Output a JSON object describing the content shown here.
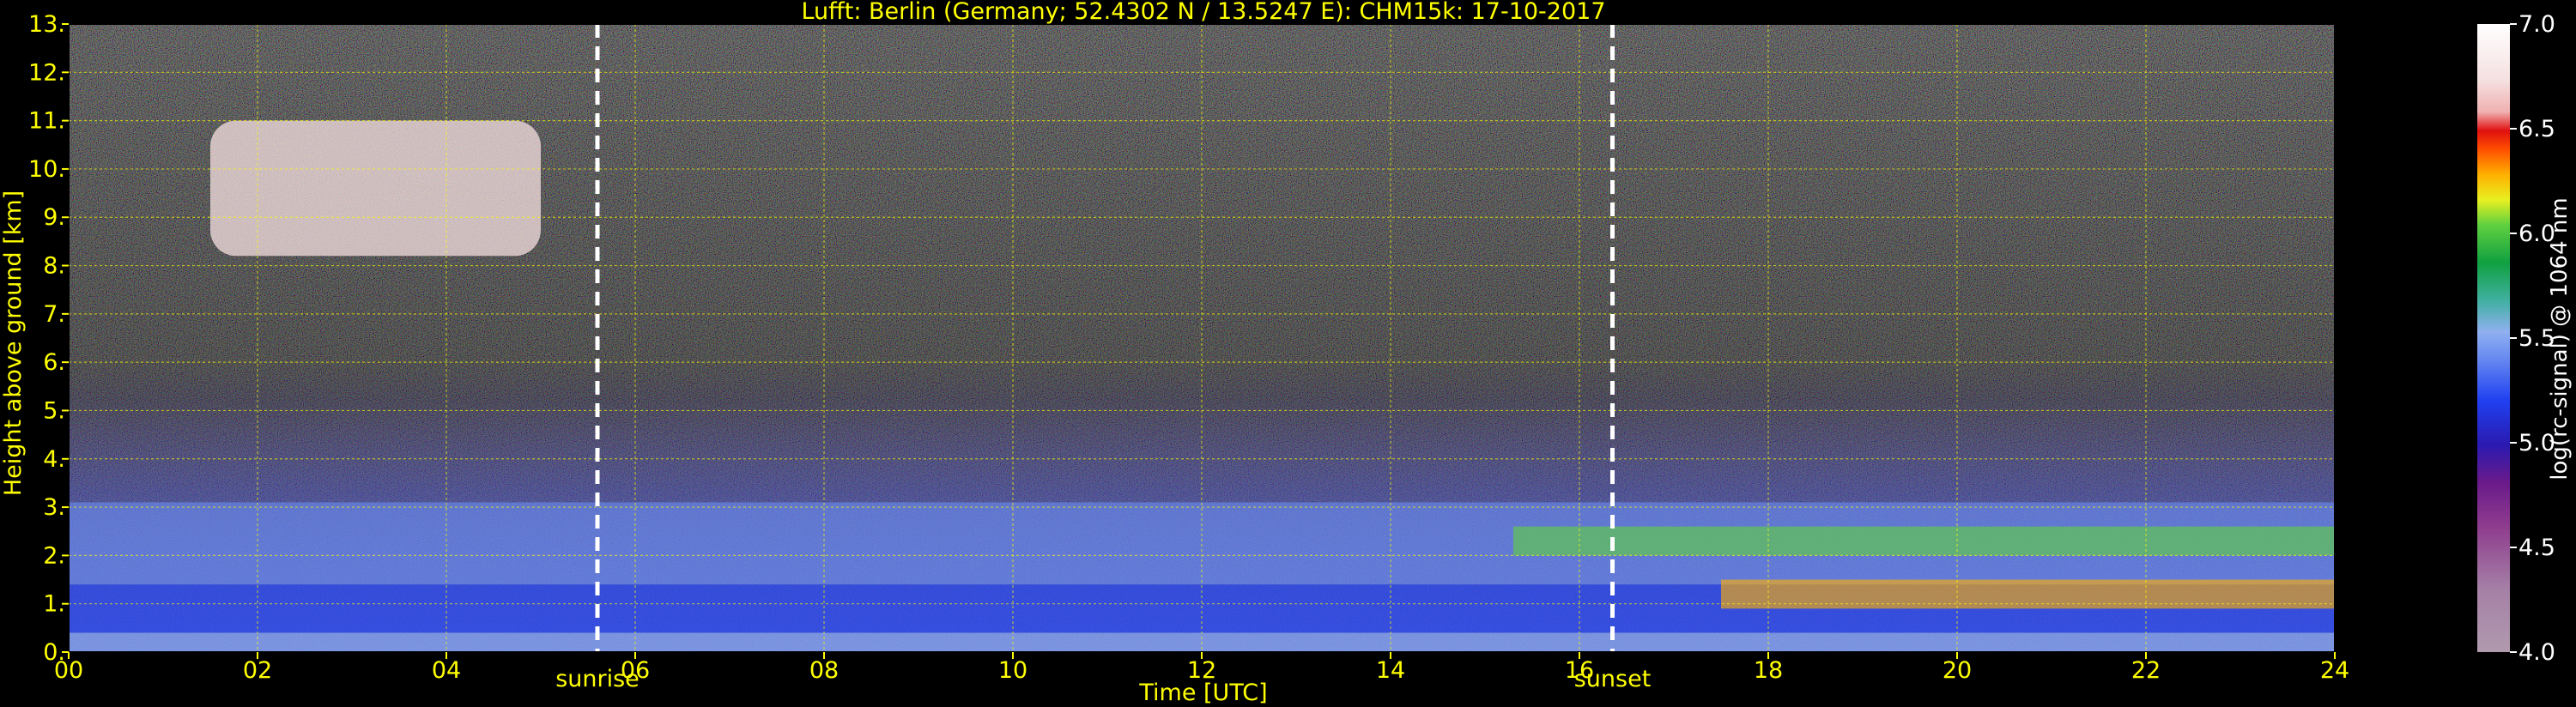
{
  "chart_data": {
    "type": "heatmap",
    "title": "Lufft: Berlin (Germany; 52.4302 N / 13.5247 E):    CHM15k: 17-10-2017",
    "xlabel": "Time [UTC]",
    "ylabel": "Height above ground [km]",
    "xlim": [
      0,
      24
    ],
    "ylim": [
      0,
      13
    ],
    "x_ticks": [
      "00",
      "02",
      "04",
      "06",
      "08",
      "10",
      "12",
      "14",
      "16",
      "18",
      "20",
      "22",
      "24"
    ],
    "y_ticks": [
      "0.",
      "1.",
      "2.",
      "3.",
      "4.",
      "5.",
      "6.",
      "7.",
      "8.",
      "9.",
      "10.",
      "11.",
      "12.",
      "13."
    ],
    "grid": true,
    "markers": [
      {
        "label": "sunrise",
        "x": 5.6
      },
      {
        "label": "sunset",
        "x": 16.35
      }
    ],
    "colorbar": {
      "label": "log(rc-signal) @ 1064 nm",
      "range": [
        4.0,
        7.0
      ],
      "ticks": [
        "4.0",
        "4.5",
        "5.0",
        "5.5",
        "6.0",
        "6.5",
        "7.0"
      ]
    },
    "layers": [
      {
        "x": [
          0,
          24
        ],
        "y": [
          0,
          0.4
        ],
        "level": 5.6
      },
      {
        "x": [
          0,
          24
        ],
        "y": [
          0.4,
          1.4
        ],
        "level": 5.3
      },
      {
        "x": [
          0,
          24
        ],
        "y": [
          1.4,
          3.1
        ],
        "level": 5.4
      },
      {
        "x": [
          15.3,
          24
        ],
        "y": [
          2.0,
          2.6
        ],
        "level": 6.1
      },
      {
        "x": [
          17.5,
          24
        ],
        "y": [
          0.9,
          1.5
        ],
        "level": 6.3
      },
      {
        "x": [
          1.5,
          5
        ],
        "y": [
          8.2,
          11.0
        ],
        "level": 6.8
      }
    ],
    "colors": {
      "background": "#000000",
      "text": "#ffff00",
      "grid": "#ffff00",
      "markers": "#ffffff"
    }
  }
}
